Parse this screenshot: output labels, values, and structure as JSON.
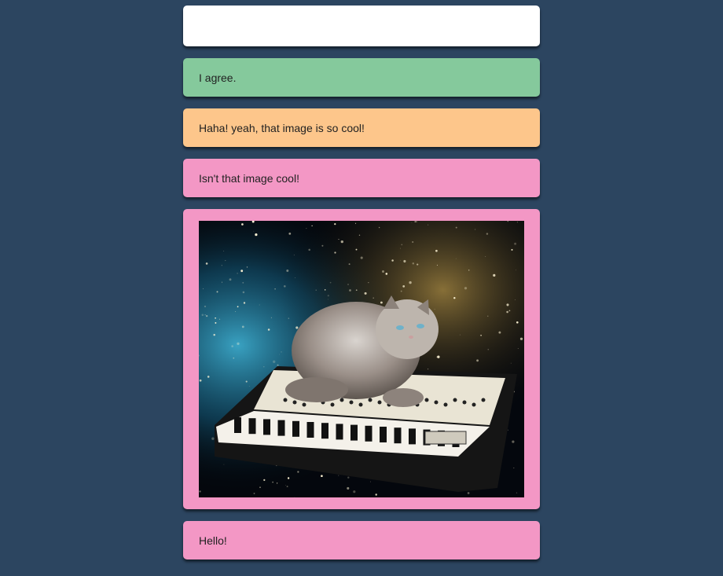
{
  "composer": {
    "value": "",
    "placeholder": ""
  },
  "messages": [
    {
      "text": "I agree.",
      "color": "#85c99c"
    },
    {
      "text": "Haha! yeah, that image is so cool!",
      "color": "#fdc68b"
    },
    {
      "text": "Isn't that image cool!",
      "color": "#f397c5"
    },
    {
      "type": "image",
      "image": "cat-on-synthesizer-in-space",
      "color": "#f397c5"
    },
    {
      "text": "Hello!",
      "color": "#f397c5"
    }
  ],
  "colors": {
    "background": "#2c4560",
    "input_background": "#ffffff"
  }
}
